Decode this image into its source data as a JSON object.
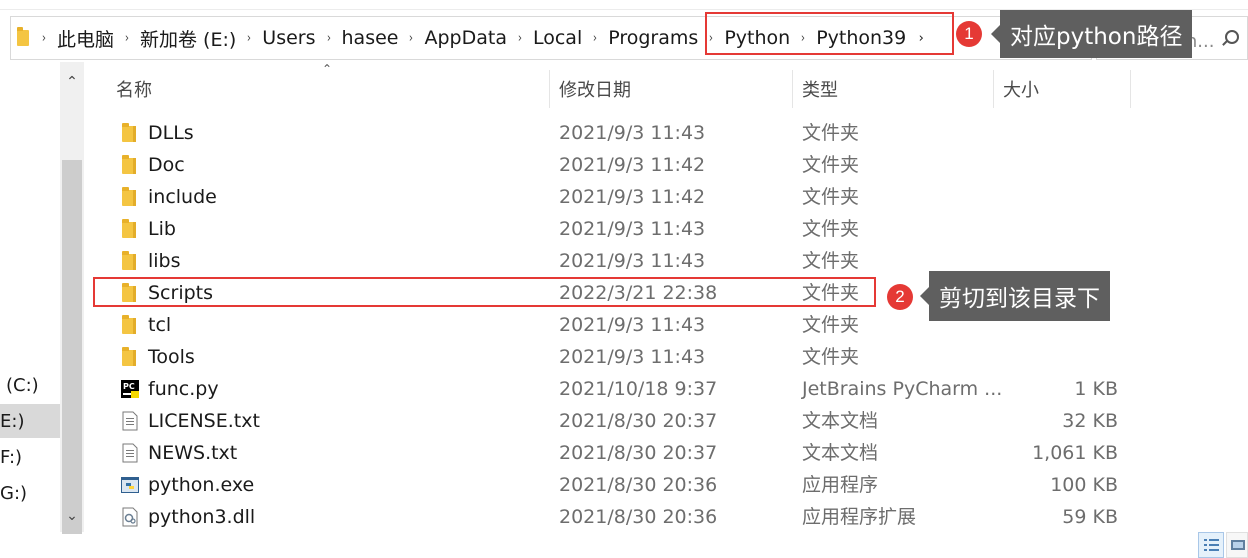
{
  "breadcrumb": {
    "items": [
      "此电脑",
      "新加卷 (E:)",
      "Users",
      "hasee",
      "AppData",
      "Local",
      "Programs",
      "Python",
      "Python39"
    ]
  },
  "search": {
    "placeholder": "搜索\"Pyth..."
  },
  "annotations": [
    {
      "number": "1",
      "text": "对应python路径"
    },
    {
      "number": "2",
      "text": "剪切到该目录下"
    }
  ],
  "nav": {
    "items": [
      "(C:)",
      "E:)",
      "F:)",
      "G:)"
    ],
    "selected_index": 1
  },
  "columns": {
    "name": "名称",
    "date": "修改日期",
    "type": "类型",
    "size": "大小"
  },
  "files": [
    {
      "name": "DLLs",
      "date": "2021/9/3 11:43",
      "type": "文件夹",
      "size": "",
      "icon": "folder-icon"
    },
    {
      "name": "Doc",
      "date": "2021/9/3 11:42",
      "type": "文件夹",
      "size": "",
      "icon": "folder-icon"
    },
    {
      "name": "include",
      "date": "2021/9/3 11:42",
      "type": "文件夹",
      "size": "",
      "icon": "folder-icon"
    },
    {
      "name": "Lib",
      "date": "2021/9/3 11:43",
      "type": "文件夹",
      "size": "",
      "icon": "folder-icon"
    },
    {
      "name": "libs",
      "date": "2021/9/3 11:43",
      "type": "文件夹",
      "size": "",
      "icon": "folder-icon"
    },
    {
      "name": "Scripts",
      "date": "2022/3/21 22:38",
      "type": "文件夹",
      "size": "",
      "icon": "folder-icon"
    },
    {
      "name": "tcl",
      "date": "2021/9/3 11:43",
      "type": "文件夹",
      "size": "",
      "icon": "folder-icon"
    },
    {
      "name": "Tools",
      "date": "2021/9/3 11:43",
      "type": "文件夹",
      "size": "",
      "icon": "folder-icon"
    },
    {
      "name": "func.py",
      "date": "2021/10/18 9:37",
      "type": "JetBrains PyCharm ...",
      "size": "1 KB",
      "icon": "pycharm-file-icon"
    },
    {
      "name": "LICENSE.txt",
      "date": "2021/8/30 20:37",
      "type": "文本文档",
      "size": "32 KB",
      "icon": "text-file-icon"
    },
    {
      "name": "NEWS.txt",
      "date": "2021/8/30 20:37",
      "type": "文本文档",
      "size": "1,061 KB",
      "icon": "text-file-icon"
    },
    {
      "name": "python.exe",
      "date": "2021/8/30 20:36",
      "type": "应用程序",
      "size": "100 KB",
      "icon": "python-exe-icon"
    },
    {
      "name": "python3.dll",
      "date": "2021/8/30 20:36",
      "type": "应用程序扩展",
      "size": "59 KB",
      "icon": "dll-file-icon"
    }
  ],
  "highlighted_file_index": 5,
  "colors": {
    "annotation_red": "#e53935",
    "tooltip_gray": "#5f5f5f",
    "folder_yellow": "#f4c542"
  }
}
